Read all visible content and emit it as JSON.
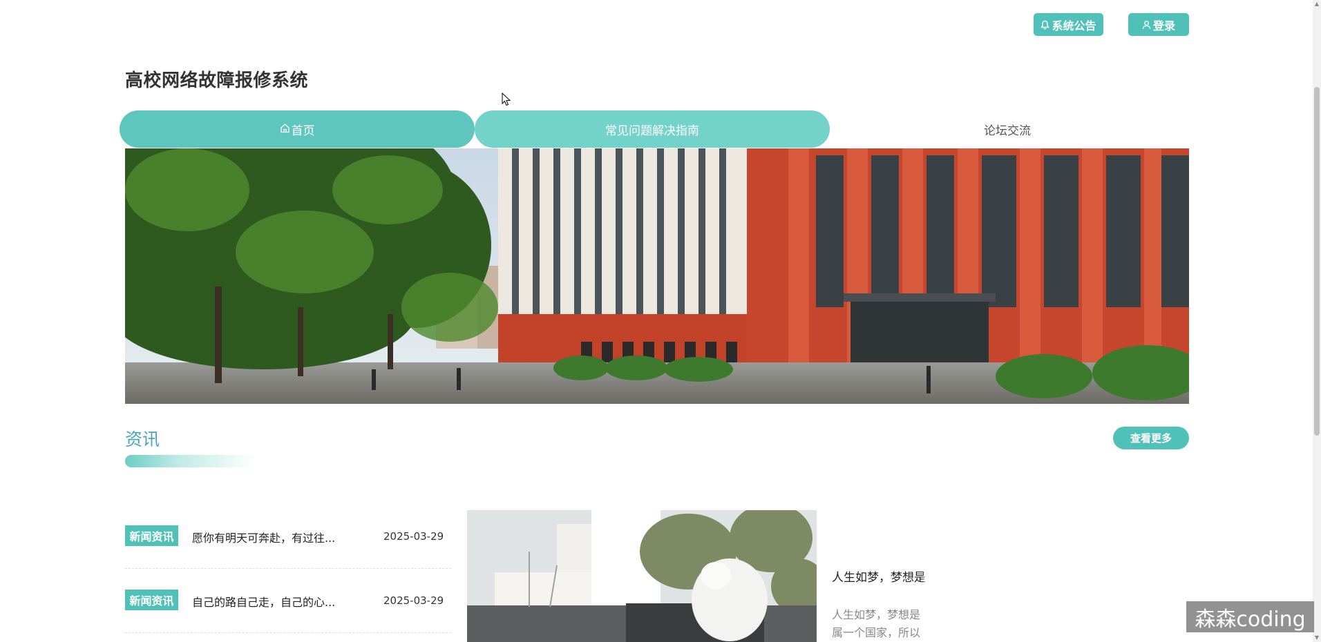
{
  "header": {
    "notice_label": "系统公告",
    "login_label": "登录",
    "icons": {
      "notice": "bell-icon",
      "login": "user-icon"
    }
  },
  "site": {
    "title": "高校网络故障报修系统"
  },
  "nav": {
    "items": [
      {
        "label": "首页",
        "icon": "home-icon",
        "active": true
      },
      {
        "label": "常见问题解决指南"
      },
      {
        "label": "论坛交流"
      }
    ]
  },
  "news": {
    "section_title": "资讯",
    "more_label": "查看更多",
    "items": [
      {
        "tag": "新闻资讯",
        "title": "愿你有明天可奔赴，有过往...",
        "date": "2025-03-29"
      },
      {
        "tag": "新闻资讯",
        "title": "自己的路自己走，自己的心...",
        "date": "2025-03-29"
      }
    ],
    "featured": {
      "title": "人生如梦，梦想是",
      "summary_line1": "人生如梦，梦想是",
      "summary_line2": "属一个国家，所以"
    }
  },
  "watermark": "森森coding",
  "colors": {
    "accent": "#4fc1b9",
    "nav_active": "#5fc6be",
    "nav_secondary": "#73d3ca",
    "section_title": "#4aa4bf"
  }
}
